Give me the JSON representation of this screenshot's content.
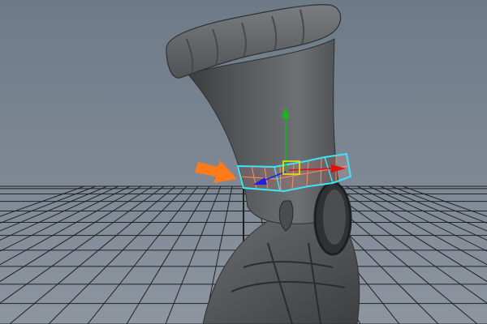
{
  "app": {
    "viewport": "perspective-viewport",
    "tool": "move-tool",
    "selection": "ankle-band-faces"
  },
  "colors": {
    "viewport_gradient_top": "#6f7c8a",
    "viewport_gradient_bottom": "#8a939d",
    "grid_line": "#1d1f21",
    "mesh_dark": "#3f4143",
    "mesh_mid": "#5d6063",
    "mesh_light": "#7d8083",
    "selection_cyan": "#34e4ff",
    "selection_face": "#e88a7a",
    "gizmo_x": "#e01010",
    "gizmo_y": "#18b818",
    "gizmo_z": "#2020e0",
    "gizmo_center": "#f2e200",
    "callout_arrow": "#ff7a1a"
  },
  "icons": {
    "callout": "arrow-right-icon",
    "manipulator": "move-manipulator-icon"
  }
}
